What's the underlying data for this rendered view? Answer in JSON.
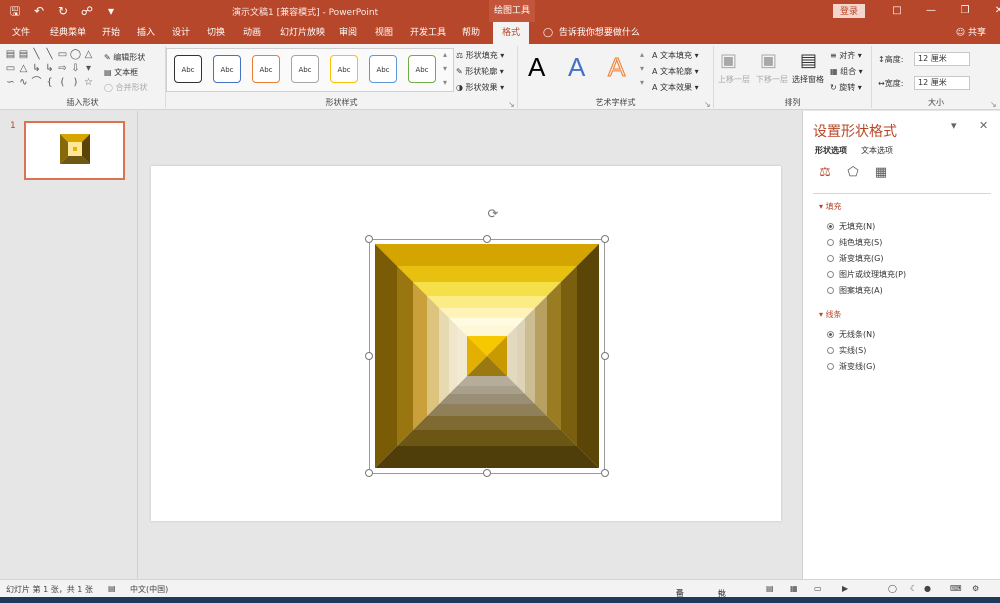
{
  "titlebar": {
    "qat_icons": [
      "save-icon",
      "undo-icon",
      "redo-icon",
      "touch-mode-icon",
      "customize-icon"
    ],
    "title": "演示文稿1 [兼容模式] - PowerPoint",
    "tools_tab": "绘图工具",
    "login": "登录"
  },
  "tabs": [
    {
      "label": "文件"
    },
    {
      "label": "经典菜单"
    },
    {
      "label": "开始"
    },
    {
      "label": "插入"
    },
    {
      "label": "设计"
    },
    {
      "label": "切换"
    },
    {
      "label": "动画"
    },
    {
      "label": "幻灯片放映"
    },
    {
      "label": "审阅"
    },
    {
      "label": "视图"
    },
    {
      "label": "开发工具"
    },
    {
      "label": "帮助"
    },
    {
      "label": "格式"
    }
  ],
  "tellme": "告诉我你想要做什么",
  "share": "共享",
  "ribbon": {
    "insert_shapes": {
      "edit_shape": "编辑形状",
      "textbox": "文本框",
      "merge_shapes": "合并形状",
      "label": "插入形状"
    },
    "shape_styles": {
      "samples": [
        "Abc",
        "Abc",
        "Abc",
        "Abc",
        "Abc",
        "Abc",
        "Abc"
      ],
      "sample_colors": [
        "#333333",
        "#4472c4",
        "#ed7d31",
        "#a5a5a5",
        "#ffc000",
        "#5b9bd5",
        "#70ad47"
      ],
      "fill": "形状填充",
      "outline": "形状轮廓",
      "effects": "形状效果",
      "label": "形状样式"
    },
    "wordart": {
      "letters": [
        "A",
        "A",
        "A"
      ],
      "text_fill": "文本填充",
      "text_outline": "文本轮廓",
      "text_effects": "文本效果",
      "label": "艺术字样式"
    },
    "arrange": {
      "bring_forward": "上移一层",
      "send_backward": "下移一层",
      "selection_pane": "选择窗格",
      "align": "对齐",
      "group": "组合",
      "rotate": "旋转",
      "label": "排列"
    },
    "size": {
      "height_label": "高度:",
      "height_value": "12 厘米",
      "width_label": "宽度:",
      "width_value": "12 厘米",
      "label": "大小"
    }
  },
  "thumbnails": {
    "slide_number": "1"
  },
  "format_pane": {
    "title": "设置形状格式",
    "tab_shape": "形状选项",
    "tab_text": "文本选项",
    "fill_heading": "填充",
    "fill_options": [
      {
        "label": "无填充(N)",
        "selected": true
      },
      {
        "label": "纯色填充(S)",
        "selected": false
      },
      {
        "label": "渐变填充(G)",
        "selected": false
      },
      {
        "label": "图片或纹理填充(P)",
        "selected": false
      },
      {
        "label": "图案填充(A)",
        "selected": false
      }
    ],
    "line_heading": "线条",
    "line_options": [
      {
        "label": "无线条(N)",
        "selected": true
      },
      {
        "label": "实线(S)",
        "selected": false
      },
      {
        "label": "渐变线(G)",
        "selected": false
      }
    ]
  },
  "statusbar": {
    "slide_info": "幻灯片 第 1 张，共 1 张",
    "language": "中文(中国)",
    "notes": "备注",
    "comments": "批注"
  }
}
